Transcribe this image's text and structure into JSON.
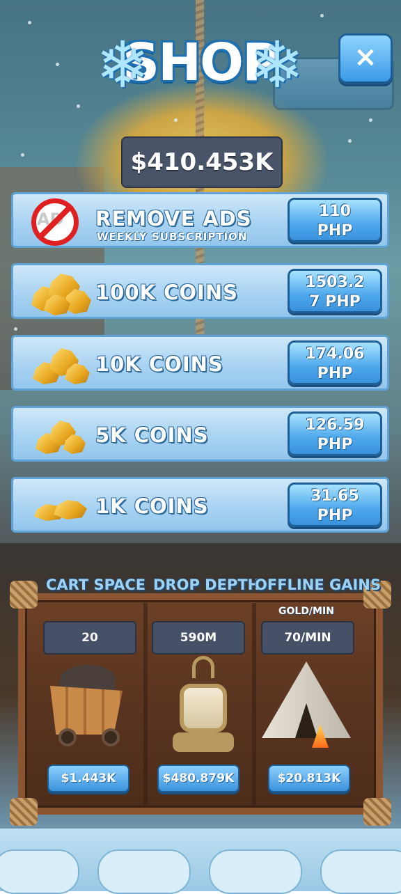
{
  "title": "SHOP",
  "close_button": "×",
  "balance": "$410.453K",
  "items": [
    {
      "title": "REMOVE ADS",
      "subtitle": "WEEKLY SUBSCRIPTION",
      "price_line1": "110",
      "price_line2": "PHP",
      "icon": "no-ads-icon"
    },
    {
      "title": "100K COINS",
      "price_line1": "1503.2",
      "price_line2": "7 PHP",
      "icon": "gold-pile-large-icon"
    },
    {
      "title": "10K COINS",
      "price_line1": "174.06",
      "price_line2": "PHP",
      "icon": "gold-pile-medium-icon"
    },
    {
      "title": "5K COINS",
      "price_line1": "126.59",
      "price_line2": "PHP",
      "icon": "gold-pile-small-icon"
    },
    {
      "title": "1K COINS",
      "price_line1": "31.65",
      "price_line2": "PHP",
      "icon": "gold-nugget-icon"
    }
  ],
  "upgrades": {
    "cart_space": {
      "label": "CART SPACE",
      "value": "20",
      "cost": "$1.443K",
      "icon": "mine-cart-icon"
    },
    "drop_depth": {
      "label": "DROP DEPTH",
      "value": "590M",
      "cost": "$480.879K",
      "icon": "lantern-icon"
    },
    "offline_gains": {
      "label": "OFFLINE GAINS",
      "sublabel": "GOLD/MIN",
      "value": "70/MIN",
      "cost": "$20.813K",
      "icon": "tent-icon"
    }
  },
  "colors": {
    "accent": "#4ea8ec",
    "row_bg": "#a9d3f2",
    "wood": "#5a3420",
    "no_ads_red": "#e02020"
  }
}
